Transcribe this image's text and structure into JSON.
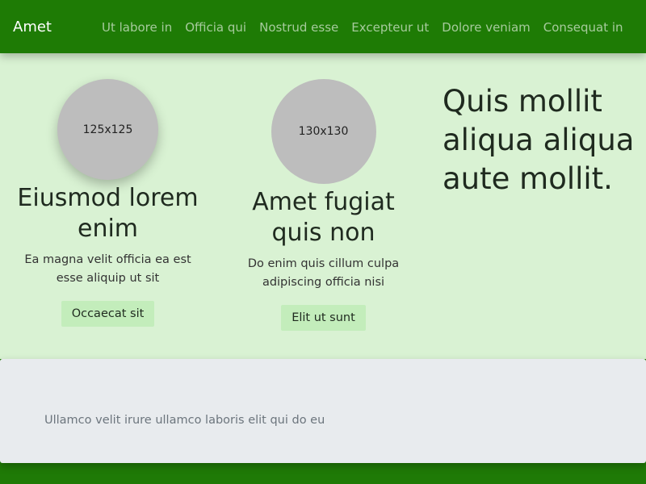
{
  "navbar": {
    "brand": "Amet",
    "links": [
      "Ut labore in",
      "Officia qui",
      "Nostrud esse",
      "Excepteur ut",
      "Dolore veniam",
      "Consequat in"
    ]
  },
  "hero": {
    "features": [
      {
        "image_label": "125x125",
        "heading": "Eiusmod lorem enim",
        "text": "Ea magna velit officia ea est esse aliquip ut sit",
        "button": "Occaecat sit"
      },
      {
        "image_label": "130x130",
        "heading": "Amet fugiat quis non",
        "text": "Do enim quis cillum culpa adipiscing officia nisi",
        "button": "Elit ut sunt"
      }
    ],
    "big_heading": "Quis mollit aliqua aliqua aute mollit."
  },
  "info": {
    "text": "Ullamco velit irure ullamco laboris elit qui do eu"
  }
}
